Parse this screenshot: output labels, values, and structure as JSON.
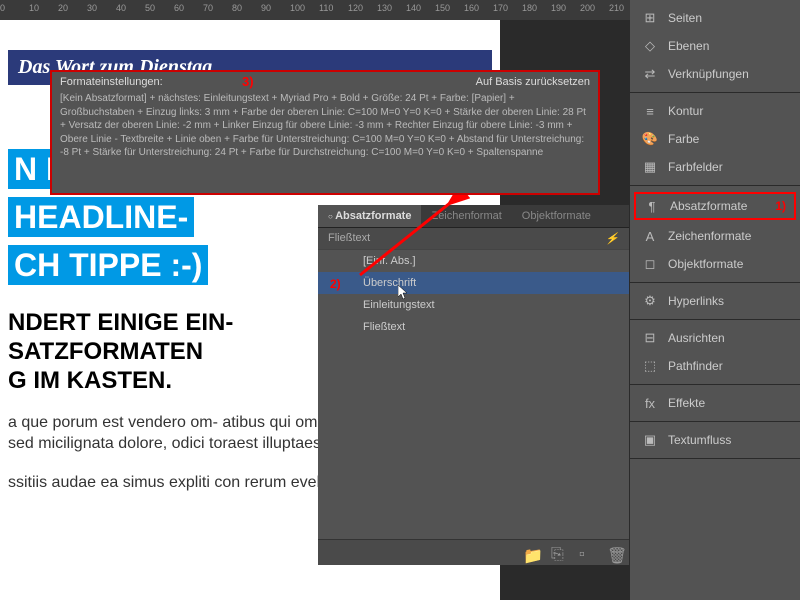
{
  "ruler": {
    "marks": [
      "0",
      "10",
      "20",
      "30",
      "40",
      "50",
      "60",
      "70",
      "80",
      "90",
      "100",
      "110",
      "120",
      "130",
      "140",
      "150",
      "160",
      "170",
      "180",
      "190",
      "200",
      "210"
    ]
  },
  "document": {
    "header": "Das Wort zum Dienstag",
    "headline_l1": "N I",
    "headline_l2": "HEADLINE-",
    "headline_l3": "CH TIPPE :-)",
    "sub_l1": "NDERT EINIGE EIN-",
    "sub_l2": "SATZFORMATEN",
    "sub_l3": "G IM KASTEN.",
    "body_p1": "a que porum est vendero om- atibus qui omnis modia vitat uat id es sed micilignata dolore, odici toraest illuptaes exerferatur",
    "body_p2": "ssitiis audae ea simus expliti con rerum evelignis dio in con."
  },
  "tooltip": {
    "title": "Formateinstellungen:",
    "reset": "Auf Basis zurücksetzen",
    "content": "[Kein Absatzformat] + nächstes: Einleitungstext + Myriad Pro + Bold + Größe: 24 Pt + Farbe: [Papier] + Großbuchstaben + Einzug links: 3 mm + Farbe der oberen Linie: C=100 M=0 Y=0 K=0 + Stärke der oberen Linie: 28 Pt + Versatz der oberen Linie: -2 mm + Linker Einzug für obere Linie: -3 mm + Rechter Einzug für obere Linie: -3 mm + Obere Linie - Textbreite + Linie oben + Farbe für Unterstreichung: C=100 M=0 Y=0 K=0 + Abstand für Unterstreichung: -8 Pt + Stärke für Unterstreichung: 24 Pt + Farbe für Durchstreichung: C=100 M=0 Y=0 K=0 + Spaltenspanne",
    "annotation": "3)"
  },
  "absatz_panel": {
    "tabs": {
      "active": "Absatzformate",
      "t2": "Zeichenformat",
      "t3": "Objektformate"
    },
    "subtitle": "Fließtext",
    "flash_icon": "⚡",
    "items": [
      {
        "label": "[Einf. Abs.]",
        "indent": true
      },
      {
        "label": "Überschrift",
        "indent": true,
        "selected": true,
        "annotation": "2)"
      },
      {
        "label": "Einleitungstext",
        "indent": true
      },
      {
        "label": "Fließtext",
        "indent": true
      }
    ],
    "footer_icons": {
      "folder": "📁",
      "clip": "⎘",
      "new": "▫",
      "trash": "🗑"
    }
  },
  "right_panel": {
    "groups": [
      [
        {
          "icon": "⊞",
          "label": "Seiten"
        },
        {
          "icon": "◇",
          "label": "Ebenen"
        },
        {
          "icon": "⇄",
          "label": "Verknüpfungen"
        }
      ],
      [
        {
          "icon": "≡",
          "label": "Kontur"
        },
        {
          "icon": "🎨",
          "label": "Farbe"
        },
        {
          "icon": "▦",
          "label": "Farbfelder"
        }
      ],
      [
        {
          "icon": "¶",
          "label": "Absatzformate",
          "highlighted": true,
          "annotation": "1)"
        },
        {
          "icon": "A",
          "label": "Zeichenformate"
        },
        {
          "icon": "◻",
          "label": "Objektformate"
        }
      ],
      [
        {
          "icon": "⚙",
          "label": "Hyperlinks"
        }
      ],
      [
        {
          "icon": "⊟",
          "label": "Ausrichten"
        },
        {
          "icon": "⬚",
          "label": "Pathfinder"
        }
      ],
      [
        {
          "icon": "fx",
          "label": "Effekte"
        }
      ],
      [
        {
          "icon": "▣",
          "label": "Textumfluss"
        }
      ]
    ]
  }
}
